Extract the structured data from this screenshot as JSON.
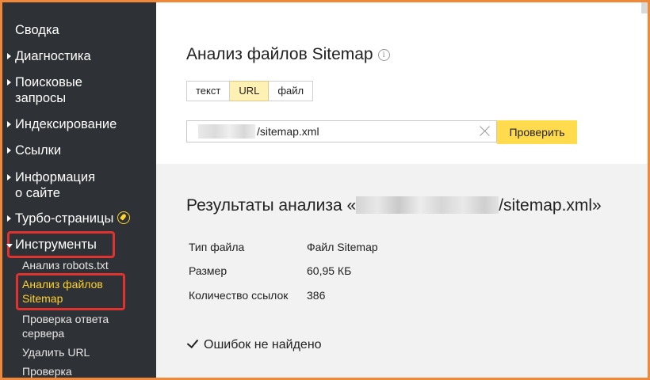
{
  "sidebar": {
    "items": [
      {
        "label": "Сводка"
      },
      {
        "label": "Диагностика"
      },
      {
        "label": "Поисковые запросы",
        "line1": "Поисковые",
        "line2": "запросы"
      },
      {
        "label": "Индексирование"
      },
      {
        "label": "Ссылки"
      },
      {
        "label": "Информация о сайте",
        "line1": "Информация",
        "line2": "о сайте"
      },
      {
        "label": "Турбо-страницы"
      },
      {
        "label": "Инструменты"
      }
    ],
    "tools": [
      {
        "label": "Анализ robots.txt"
      },
      {
        "label": "Анализ файлов Sitemap",
        "line1": "Анализ файлов",
        "line2": "Sitemap"
      },
      {
        "label": "Проверка ответа сервера",
        "line1": "Проверка ответа",
        "line2": "сервера"
      },
      {
        "label": "Удалить URL"
      },
      {
        "label": "Проверка"
      }
    ]
  },
  "main": {
    "title": "Анализ файлов Sitemap",
    "info_icon": "i",
    "tabs": [
      "текст",
      "URL",
      "файл"
    ],
    "active_tab": "URL",
    "url_value": "/sitemap.xml",
    "check_button": "Проверить",
    "results": {
      "title_prefix": "Результаты анализа «",
      "title_suffix": "/sitemap.xml»",
      "rows": [
        {
          "label": "Тип файла",
          "value": "Файл Sitemap"
        },
        {
          "label": "Размер",
          "value": "60,95 КБ"
        },
        {
          "label": "Количество ссылок",
          "value": "386"
        }
      ],
      "status": "Ошибок не найдено"
    }
  },
  "colors": {
    "sidebar_bg": "#2e3135",
    "active_link": "#ffd22e",
    "highlight_box": "#e0322e",
    "button_bg": "#ffdb4d",
    "frame_border": "#f0883a"
  }
}
